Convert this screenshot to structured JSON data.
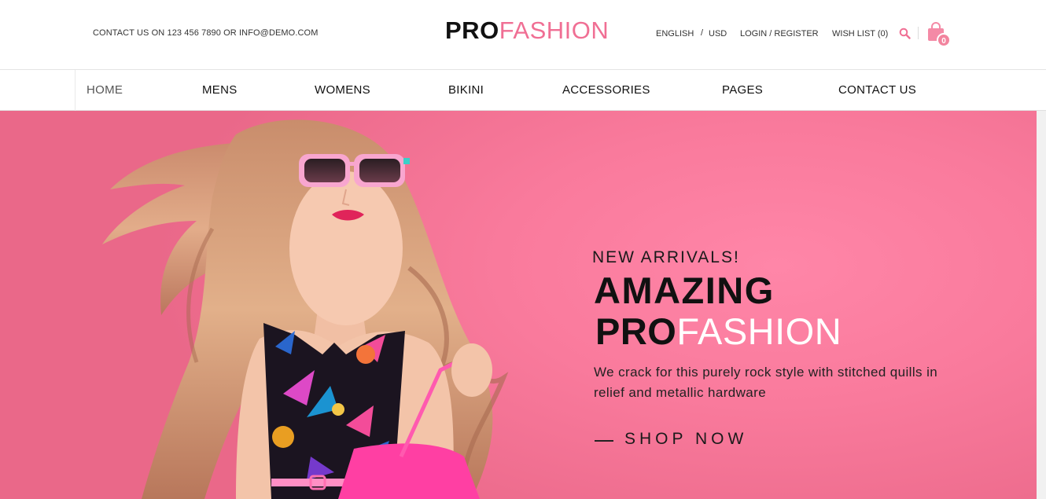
{
  "header": {
    "contact_text": "CONTACT US ON 123 456 7890 OR INFO@DEMO.COM",
    "logo": {
      "bold": "PRO",
      "light": "FASHION"
    },
    "language": "ENGLISH",
    "separator": "/",
    "currency": "USD",
    "login_register": "LOGIN / REGISTER",
    "wishlist": "WISH LIST (0)",
    "cart_count": "0",
    "accent_color": "#f06f94"
  },
  "nav": {
    "items": [
      {
        "label": "HOME",
        "active": true
      },
      {
        "label": "MENS"
      },
      {
        "label": "WOMENS"
      },
      {
        "label": "BIKINI"
      },
      {
        "label": "ACCESSORIES"
      },
      {
        "label": "PAGES"
      },
      {
        "label": "CONTACT US"
      }
    ]
  },
  "hero": {
    "kicker": "NEW ARRIVALS!",
    "headline_line1": "AMAZING",
    "headline_line2": {
      "bold": "PRO",
      "light": "FASHION"
    },
    "description": "We crack for this purely rock style with stitched quills in relief and metallic hardware",
    "cta": "SHOP NOW",
    "background_color": "#f97a9c"
  },
  "icons": {
    "search": "search-icon",
    "cart": "shopping-bag-icon"
  }
}
